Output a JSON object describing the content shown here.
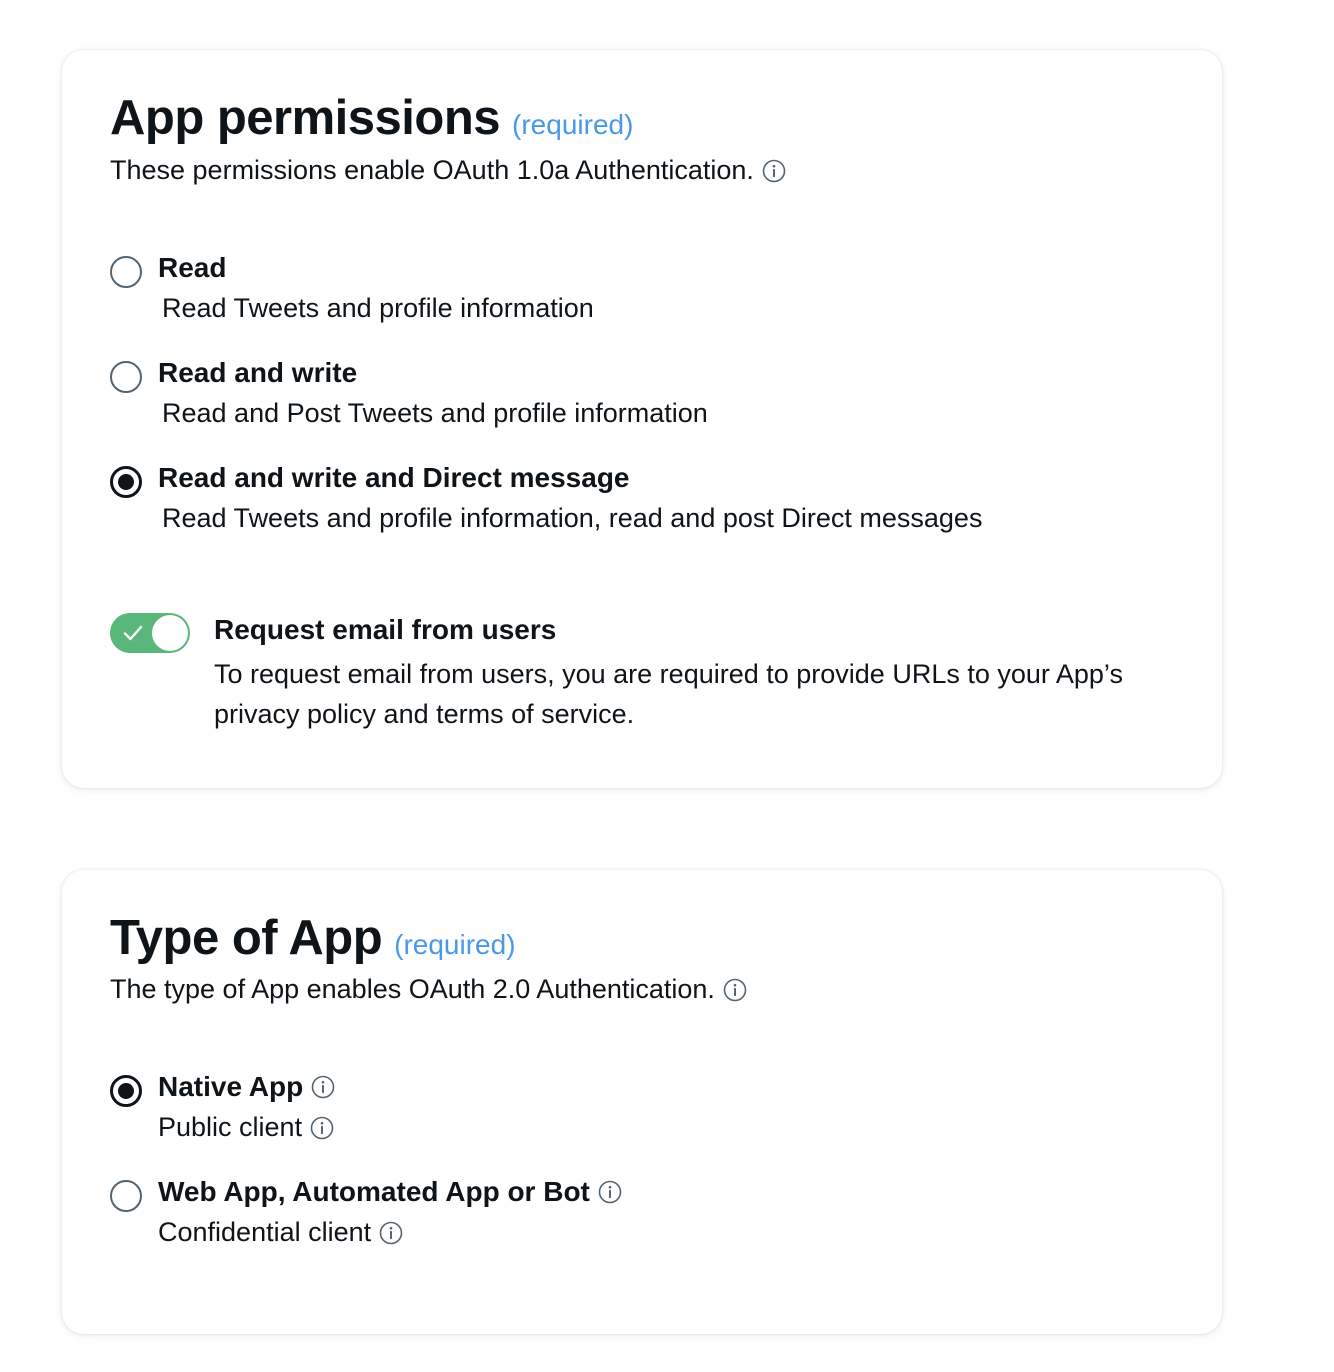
{
  "colors": {
    "accent_blue": "#4a99e9",
    "toggle_on": "#59b77a",
    "text": "#0f1419"
  },
  "permissions": {
    "title": "App permissions",
    "required": "(required)",
    "subtitle": "These permissions enable OAuth 1.0a Authentication.",
    "options": [
      {
        "label": "Read",
        "description": "Read Tweets and profile information",
        "selected": false
      },
      {
        "label": "Read and write",
        "description": "Read and Post Tweets and profile information",
        "selected": false
      },
      {
        "label": "Read and write and Direct message",
        "description": "Read Tweets and profile information, read and post Direct messages",
        "selected": true
      }
    ],
    "email_toggle": {
      "label": "Request email from users",
      "description": "To request email from users, you are required to provide URLs to your App’s privacy policy and terms of service.",
      "on": true
    }
  },
  "app_type": {
    "title": "Type of App",
    "required": "(required)",
    "subtitle": "The type of App enables OAuth 2.0 Authentication.",
    "options": [
      {
        "label": "Native App",
        "description": "Public client",
        "selected": true
      },
      {
        "label": "Web App, Automated App or Bot",
        "description": "Confidential client",
        "selected": false
      }
    ]
  },
  "icons": {
    "info": "info-circle-icon",
    "check": "checkmark-icon"
  }
}
